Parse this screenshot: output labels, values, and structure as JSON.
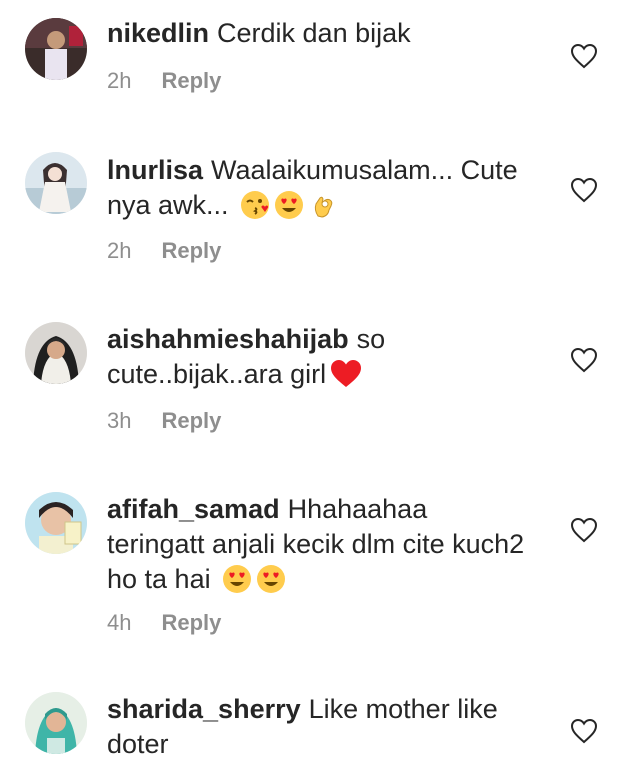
{
  "reply_label": "Reply",
  "colors": {
    "text": "#262626",
    "meta": "#8e8e8e",
    "heart_outline": "#262626",
    "heart_emoji": "#ed1c24",
    "emoji_face": "#ffcc4d"
  },
  "comments": [
    {
      "username": "nikedlin",
      "text": "Cerdik dan bijak",
      "time": "2h",
      "emojis": []
    },
    {
      "username": "lnurlisa",
      "text": "Waalaikumusalam... Cute nya awk...",
      "time": "2h",
      "emojis": [
        "kissing-heart-emoji",
        "heart-eyes-emoji",
        "ok-hand-emoji"
      ]
    },
    {
      "username": "aishahmieshahijab",
      "text": "so cute..bijak..ara girl",
      "time": "3h",
      "emojis": [
        "red-heart-emoji"
      ]
    },
    {
      "username": "afifah_samad",
      "text": "Hhahaahaa teringatt anjali kecik dlm cite kuch2 ho ta hai",
      "time": "4h",
      "emojis": [
        "heart-eyes-emoji",
        "heart-eyes-emoji"
      ]
    },
    {
      "username": "sharida_sherry",
      "text": "Like mother like doter",
      "time": "",
      "emojis": []
    }
  ]
}
